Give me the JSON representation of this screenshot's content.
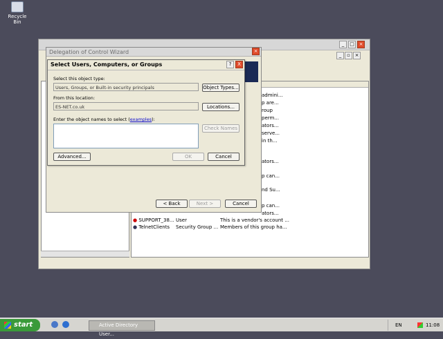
{
  "desktop": {
    "recycle_bin_label": "Recycle Bin"
  },
  "ad_window": {
    "rows": [
      {
        "col3": "admini..."
      },
      {
        "col3": "p are..."
      },
      {
        "col3": "roup"
      },
      {
        "col3": "perm..."
      },
      {
        "col3": "ators..."
      },
      {
        "col3": "serve..."
      },
      {
        "col3": "in th..."
      },
      {
        "col3": "ators..."
      },
      {
        "col3": "p can..."
      },
      {
        "col3": "nd Su..."
      },
      {
        "col3": "p can..."
      },
      {
        "col3": "ators..."
      }
    ],
    "bottom_rows": [
      {
        "name": "SUPPORT_38...",
        "type": "User",
        "desc": "This is a vendor's account ..."
      },
      {
        "name": "TelnetClients",
        "type": "Security Group ...",
        "desc": "Members of this group ha..."
      }
    ]
  },
  "wizard": {
    "title": "Delegation of Control Wizard",
    "back_label": "< Back",
    "next_label": "Next >",
    "cancel_label": "Cancel"
  },
  "select_dialog": {
    "title": "Select Users, Computers, or Groups",
    "help_btn": "?",
    "close_btn": "X",
    "object_type_label": "Select this object type:",
    "object_type_value": "Users, Groups, or Built-in security principals",
    "object_types_btn": "Object Types...",
    "location_label": "From this location:",
    "location_value": "ES-NET.co.uk",
    "locations_btn": "Locations...",
    "names_label": "Enter the object names to select (",
    "names_link": "examples",
    "names_label_end": "):",
    "check_names_btn": "Check Names",
    "advanced_btn": "Advanced...",
    "ok_btn": "OK",
    "cancel_btn": "Cancel"
  },
  "taskbar": {
    "start_label": "start",
    "task_label": "Active Directory User...",
    "lang": "EN",
    "clock": "11:08"
  }
}
